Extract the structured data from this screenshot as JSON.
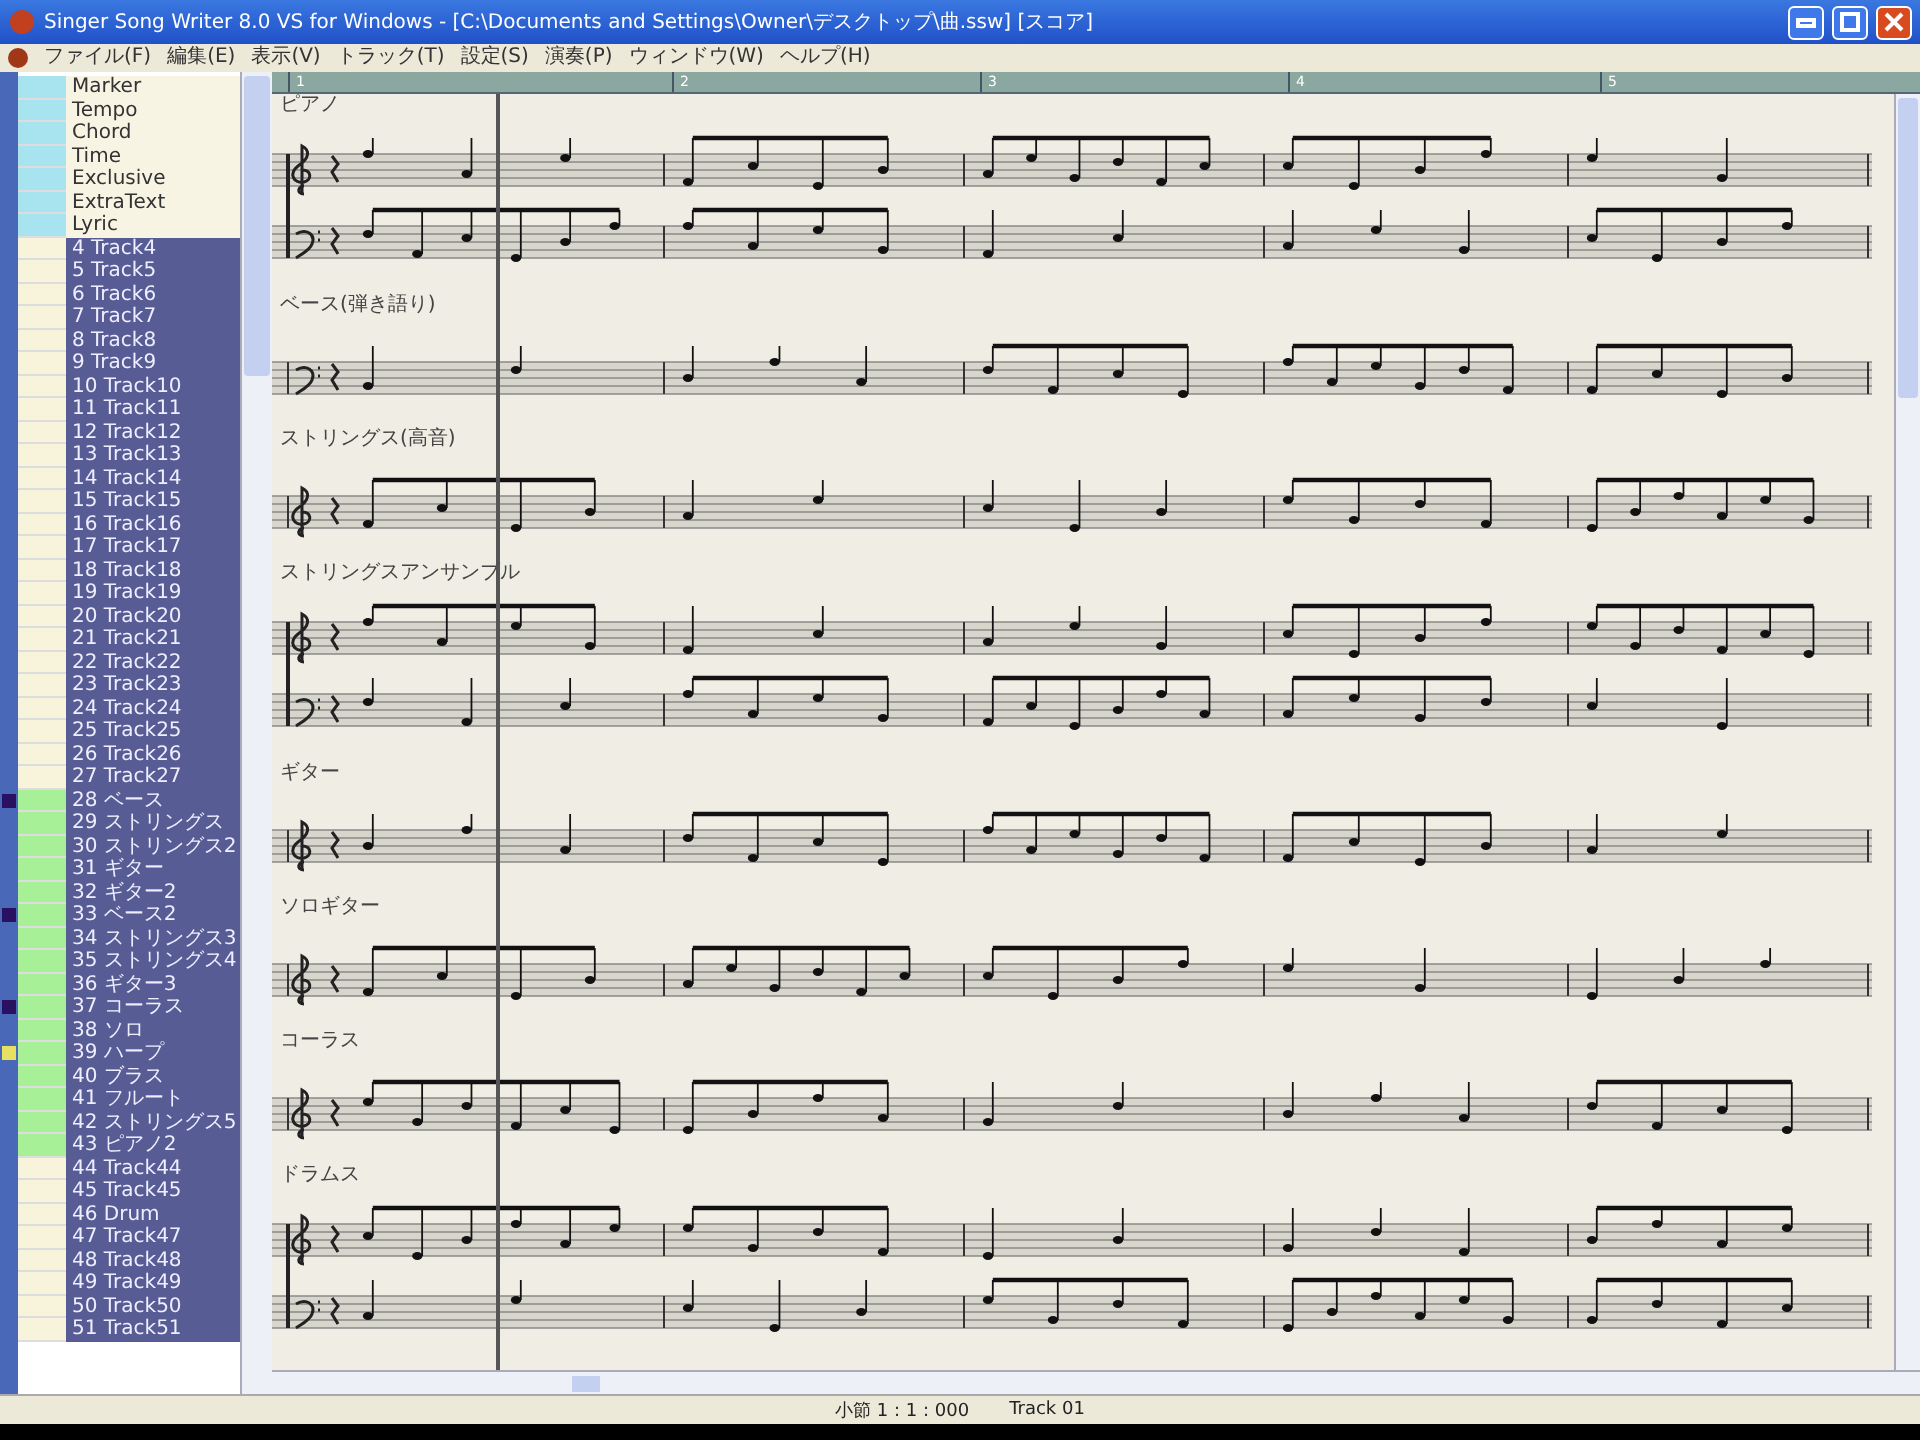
{
  "window": {
    "title": "Singer Song Writer 8.0 VS for Windows - [C:\\Documents and Settings\\Owner\\デスクトップ\\曲.ssw] [スコア]"
  },
  "menu": [
    "ファイル(F)",
    "編集(E)",
    "表示(V)",
    "トラック(T)",
    "設定(S)",
    "演奏(P)",
    "ウィンドウ(W)",
    "ヘルプ(H)"
  ],
  "conductor_tracks": [
    {
      "label": "Marker"
    },
    {
      "label": "Tempo"
    },
    {
      "label": "Chord"
    },
    {
      "label": "Time"
    },
    {
      "label": "Exclusive"
    },
    {
      "label": "ExtraText"
    },
    {
      "label": "Lyric"
    }
  ],
  "tracks": [
    {
      "label": "4 Track4",
      "active": false
    },
    {
      "label": "5 Track5",
      "active": false
    },
    {
      "label": "6 Track6",
      "active": false
    },
    {
      "label": "7 Track7",
      "active": false
    },
    {
      "label": "8 Track8",
      "active": false
    },
    {
      "label": "9 Track9",
      "active": false
    },
    {
      "label": "10 Track10",
      "active": false
    },
    {
      "label": "11 Track11",
      "active": false
    },
    {
      "label": "12 Track12",
      "active": false
    },
    {
      "label": "13 Track13",
      "active": false
    },
    {
      "label": "14 Track14",
      "active": false
    },
    {
      "label": "15 Track15",
      "active": false
    },
    {
      "label": "16 Track16",
      "active": false
    },
    {
      "label": "17 Track17",
      "active": false
    },
    {
      "label": "18 Track18",
      "active": false
    },
    {
      "label": "19 Track19",
      "active": false
    },
    {
      "label": "20 Track20",
      "active": false
    },
    {
      "label": "21 Track21",
      "active": false
    },
    {
      "label": "22 Track22",
      "active": false
    },
    {
      "label": "23 Track23",
      "active": false
    },
    {
      "label": "24 Track24",
      "active": false
    },
    {
      "label": "25 Track25",
      "active": false
    },
    {
      "label": "26 Track26",
      "active": false
    },
    {
      "label": "27 Track27",
      "active": false
    },
    {
      "label": "28 ベース",
      "active": true,
      "color": "#2a1060"
    },
    {
      "label": "29 ストリングス",
      "active": true
    },
    {
      "label": "30 ストリングス2",
      "active": true
    },
    {
      "label": "31 ギター",
      "active": true
    },
    {
      "label": "32 ギター2",
      "active": true
    },
    {
      "label": "33 ベース2",
      "active": true,
      "color": "#2a1060"
    },
    {
      "label": "34 ストリングス3",
      "active": true
    },
    {
      "label": "35 ストリングス4",
      "active": true
    },
    {
      "label": "36 ギター3",
      "active": true
    },
    {
      "label": "37 コーラス",
      "active": true,
      "color": "#2a1060"
    },
    {
      "label": "38 ソロ",
      "active": true
    },
    {
      "label": "39 ハープ",
      "active": true,
      "color": "#e8e060"
    },
    {
      "label": "40 ブラス",
      "active": true
    },
    {
      "label": "41 フルート",
      "active": true
    },
    {
      "label": "42 ストリングス5",
      "active": true
    },
    {
      "label": "43 ピアノ2",
      "active": true
    },
    {
      "label": "44 Track44",
      "active": false
    },
    {
      "label": "45 Track45",
      "active": false
    },
    {
      "label": "46 Drum",
      "active": false
    },
    {
      "label": "47 Track47",
      "active": false
    },
    {
      "label": "48 Track48",
      "active": false
    },
    {
      "label": "49 Track49",
      "active": false
    },
    {
      "label": "50 Track50",
      "active": false
    },
    {
      "label": "51 Track51",
      "active": false
    }
  ],
  "ruler": [
    "1",
    "2",
    "3",
    "4",
    "5"
  ],
  "staves": [
    {
      "label": "ピアノ",
      "kind": "grand"
    },
    {
      "label": "ベース(弾き語り)",
      "kind": "bass"
    },
    {
      "label": "ストリングス(高音)",
      "kind": "treble"
    },
    {
      "label": "ストリングスアンサンブル",
      "kind": "grand"
    },
    {
      "label": "ギター",
      "kind": "treble"
    },
    {
      "label": "ソロギター",
      "kind": "treble"
    },
    {
      "label": "コーラス",
      "kind": "treble"
    },
    {
      "label": "ドラムス",
      "kind": "grand"
    }
  ],
  "status_bar": [
    "小節 1 : 1 : 000",
    "Track 01"
  ]
}
